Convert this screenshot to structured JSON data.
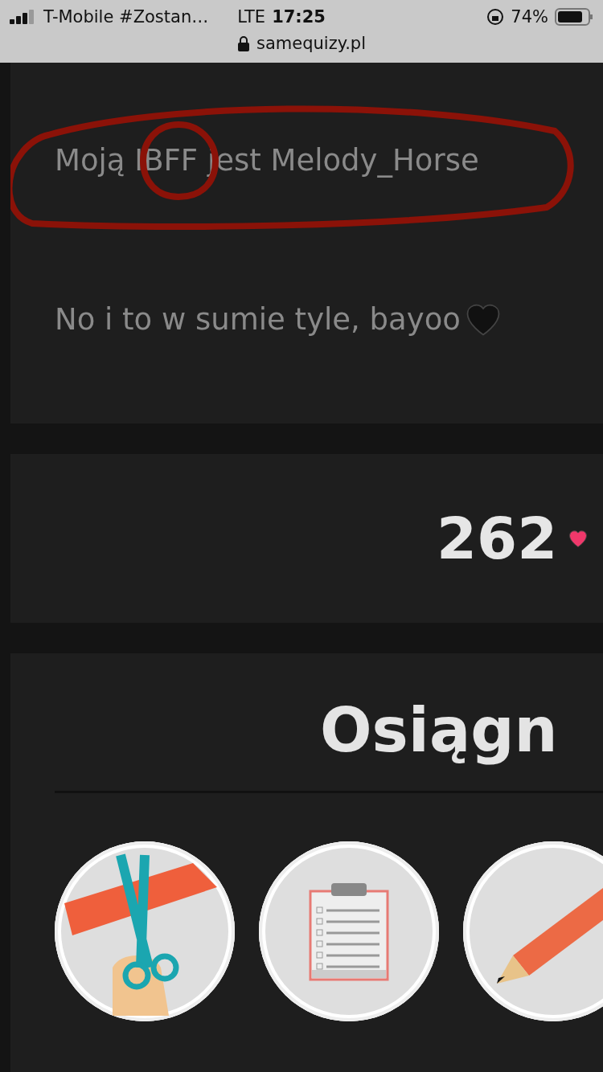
{
  "status_bar": {
    "carrier": "T-Mobile #Zostan…",
    "network": "LTE",
    "time": "17:25",
    "battery": "74%"
  },
  "address_bar": {
    "url": "samequizy.pl"
  },
  "text_card": {
    "paragraphs": [
      "Moją IBFF jest Melody_Horse",
      "No i to w sumie tyle, bayoo"
    ]
  },
  "likes_card": {
    "count": "262"
  },
  "achievements": {
    "title": "Osiągn",
    "badges": [
      {
        "kind": "scissors"
      },
      {
        "kind": "clipboard"
      },
      {
        "kind": "pencil"
      }
    ]
  }
}
